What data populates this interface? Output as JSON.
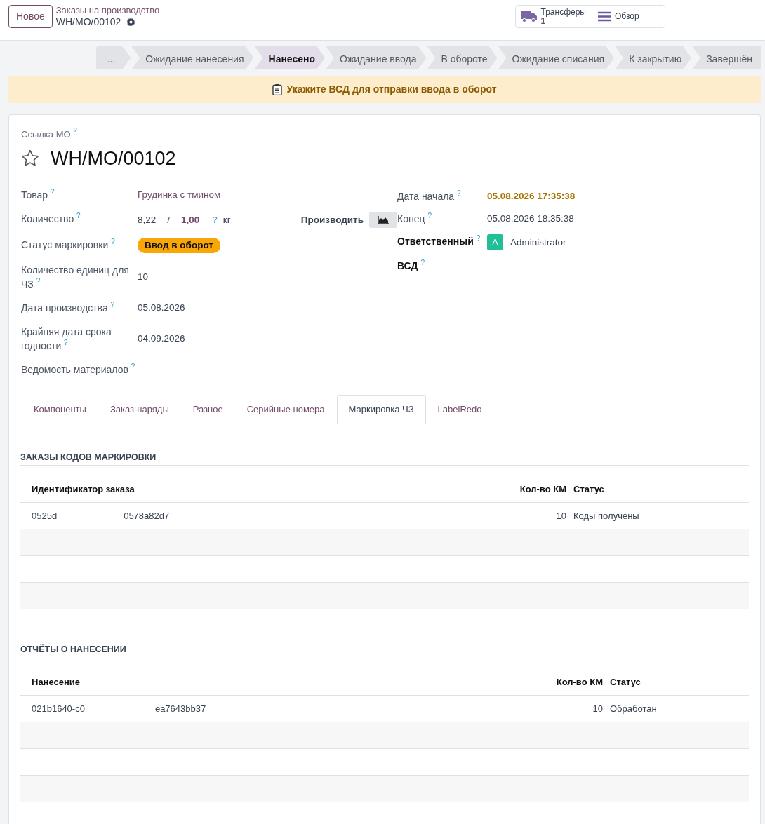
{
  "new_button": "Новое",
  "breadcrumb": {
    "parent": "Заказы на производство",
    "current": "WH/MO/00102"
  },
  "smart_buttons": [
    {
      "kind": "truck",
      "label": "Трансферы",
      "count": "1"
    },
    {
      "kind": "menu",
      "label": "Обзор"
    }
  ],
  "statusbar": [
    {
      "label": "...",
      "selected": false
    },
    {
      "label": "Ожидание нанесения",
      "selected": false
    },
    {
      "label": "Нанесено",
      "selected": true
    },
    {
      "label": "Ожидание ввода",
      "selected": false
    },
    {
      "label": "В обороте",
      "selected": false
    },
    {
      "label": "Ожидание списания",
      "selected": false
    },
    {
      "label": "К закрытию",
      "selected": false
    },
    {
      "label": "Завершён",
      "selected": false
    }
  ],
  "alert": "Укажите ВСД для отправки ввода в оборот",
  "record": {
    "ref_label": "Ссылка МО $^{?}$",
    "starred": false,
    "title": "WH/MO/00102"
  },
  "left_fields": [
    {
      "kind": "link",
      "label": "Товар $^{?}$",
      "required": false,
      "value": "Грудинка с тмином"
    },
    {
      "kind": "quantity",
      "label": "Количество $^{?}$",
      "required": false,
      "produced": "8,22",
      "separator": "/",
      "planned": "1,00",
      "help": "?",
      "uom": "кг",
      "action": "Производить"
    },
    {
      "kind": "badge",
      "label": "Статус маркировки $^{?}$",
      "required": false,
      "value": "Ввод в оборот"
    },
    {
      "kind": "text",
      "label": "Количество единиц для ЧЗ $^{?}$",
      "required": false,
      "value": "10"
    },
    {
      "kind": "text",
      "label": "Дата производства $^{?}$",
      "required": false,
      "value": "05.08.2026"
    },
    {
      "kind": "text",
      "label": "Крайняя дата срока годности $^{?}$",
      "required": false,
      "value": "04.09.2026"
    },
    {
      "kind": "empty",
      "label": "Ведомость материалов $^{?}$",
      "required": false
    }
  ],
  "right_fields": [
    {
      "kind": "text",
      "label": "Дата начала $^{?}$",
      "required": false,
      "highlight": true,
      "value": "05.08.2026 17:35:38"
    },
    {
      "kind": "text",
      "label": "Конец $^{?}$",
      "required": false,
      "highlight": false,
      "value": "05.08.2026 18:35:38"
    },
    {
      "kind": "user",
      "label": "Ответственный $^{?}$",
      "required": true,
      "initial": "A",
      "value": "Administrator"
    },
    {
      "kind": "empty",
      "label": "ВСД $^{?}$",
      "required": true
    }
  ],
  "tabs": [
    {
      "label": "Компоненты",
      "selected": false
    },
    {
      "label": "Заказ-наряды",
      "selected": false
    },
    {
      "label": "Разное",
      "selected": false
    },
    {
      "label": "Серийные номера",
      "selected": false
    },
    {
      "label": "Маркировка ЧЗ",
      "selected": true
    },
    {
      "label": "LabelRedo",
      "selected": false
    }
  ],
  "sections": [
    {
      "title": "ЗАКАЗЫ КОДОВ МАРКИРОВКИ",
      "columns": [
        "Идентификатор заказа",
        "Кол-во КМ",
        "Статус"
      ],
      "rows": [
        {
          "id_parts": [
            "0525d",
            "0578a82d7"
          ],
          "count": "10",
          "status": "Коды получены"
        }
      ]
    },
    {
      "title": "ОТЧЁТЫ О НАНЕСЕНИИ",
      "columns": [
        "Нанесение",
        "Кол-во КМ",
        "Статус"
      ],
      "rows": [
        {
          "id_parts": [
            "021b1640-c0",
            "ea7643bb37"
          ],
          "count": "10",
          "status": "Обработан"
        }
      ]
    }
  ]
}
